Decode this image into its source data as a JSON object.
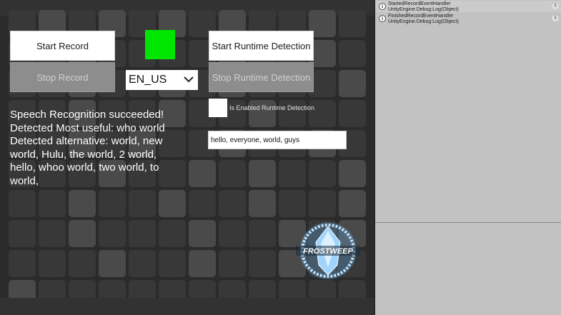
{
  "buttons": {
    "start_record": "Start Record",
    "stop_record": "Stop Record",
    "start_runtime": "Start Runtime Detection",
    "stop_runtime": "Stop Runtime Detection"
  },
  "language": {
    "selected": "EN_US"
  },
  "runtime_toggle": {
    "label": "Is Enabled Runtime Detection",
    "checked": false
  },
  "keywords": {
    "value": "hello, everyone, world, guys"
  },
  "result": {
    "line1": "Speech Recognition succeeded!",
    "line2": "Detected Most useful: who world",
    "line3": "Detected alternative: world, new world, Hulu, the world, 2 world, hello, whoo world, two world, to world,"
  },
  "logo": {
    "text": "FROSTWEEP"
  },
  "colors": {
    "status_indicator": "#00e600",
    "tile": "#383838",
    "tile_light": "#4a4a4a"
  },
  "console": {
    "entries": [
      {
        "icon": "info-icon",
        "title": "StartedRecordEventHandler",
        "detail": "UnityEngine.Debug:Log(Object)",
        "count": "1"
      },
      {
        "icon": "info-icon",
        "title": "FinishedRecordEventHandler",
        "detail": "UnityEngine.Debug:Log(Object)",
        "count": "1"
      }
    ]
  }
}
